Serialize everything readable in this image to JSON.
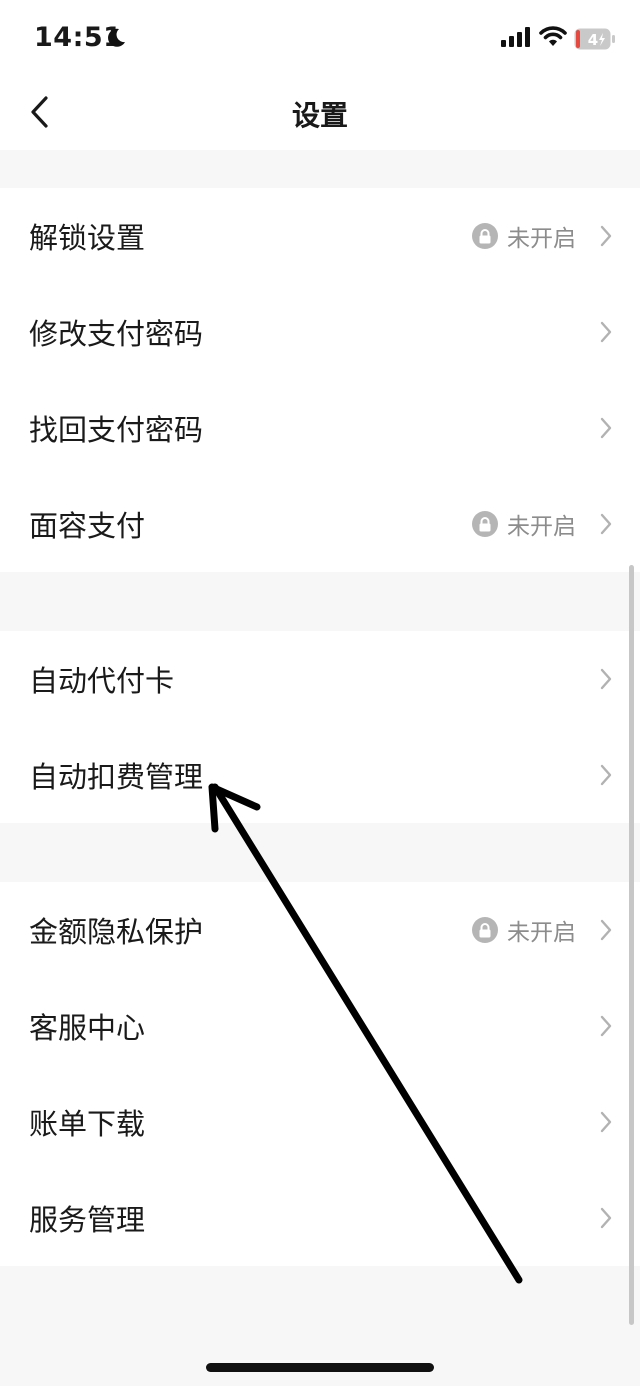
{
  "status_bar": {
    "time": "14:51",
    "battery": "4",
    "icons": [
      "moon-icon",
      "cellular-signal-icon",
      "wifi-icon",
      "battery-charging-icon"
    ]
  },
  "nav": {
    "title": "设置",
    "back_icon": "chevron-left-icon"
  },
  "groups": [
    {
      "items": [
        {
          "label": "解锁设置",
          "status": "未开启"
        },
        {
          "label": "修改支付密码"
        },
        {
          "label": "找回支付密码"
        },
        {
          "label": "面容支付",
          "status": "未开启"
        }
      ]
    },
    {
      "items": [
        {
          "label": "自动代付卡"
        },
        {
          "label": "自动扣费管理"
        }
      ]
    },
    {
      "items": [
        {
          "label": "金额隐私保护",
          "status": "未开启"
        },
        {
          "label": "客服中心"
        },
        {
          "label": "账单下载"
        },
        {
          "label": "服务管理"
        }
      ]
    }
  ],
  "colors": {
    "background": "#f7f7f7",
    "card": "#ffffff",
    "text": "#1a1a1a",
    "secondary_text": "#8c8c8c",
    "chevron": "#b2b2b2",
    "annotation_arrow": "#000000"
  }
}
